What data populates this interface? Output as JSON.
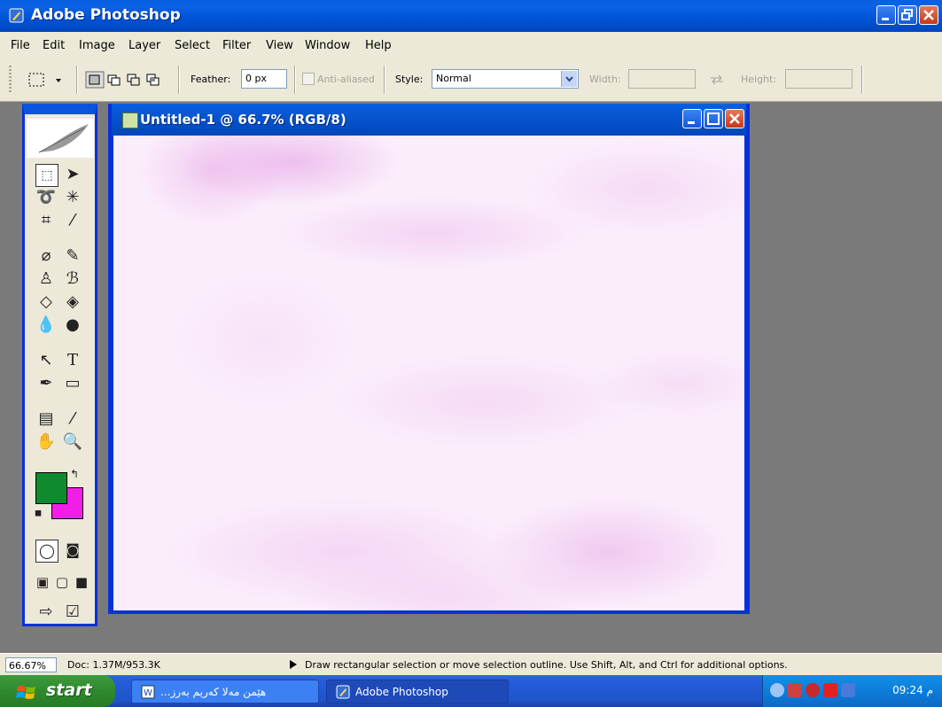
{
  "window": {
    "title": "Adobe Photoshop"
  },
  "menu": [
    "File",
    "Edit",
    "Image",
    "Layer",
    "Select",
    "Filter",
    "View",
    "Window",
    "Help"
  ],
  "options": {
    "feather_label": "Feather:",
    "feather_value": "0 px",
    "antialiased_label": "Anti-aliased",
    "style_label": "Style:",
    "style_value": "Normal",
    "width_label": "Width:",
    "height_label": "Height:"
  },
  "document": {
    "title": "Untitled-1 @ 66.7% (RGB/8)"
  },
  "colors": {
    "foreground": "#0f8a2f",
    "background": "#f21ee8"
  },
  "status": {
    "zoom": "66.67%",
    "doc": "Doc: 1.37M/953.3K",
    "message": "Draw rectangular selection or move selection outline.  Use Shift, Alt, and Ctrl for additional options."
  },
  "taskbar": {
    "start": "start",
    "items": [
      "...هێمن مەلا کەریم بەرز",
      "Adobe Photoshop"
    ],
    "clock": "09:24 م"
  }
}
